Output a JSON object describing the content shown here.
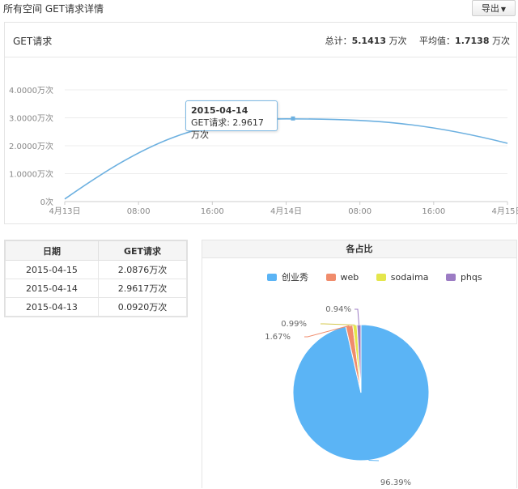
{
  "header": {
    "title": "所有空间 GET请求详情",
    "export_label": "导出"
  },
  "chart_panel": {
    "title": "GET请求",
    "total_label": "总计：",
    "total_value": "5.1413",
    "total_unit": "万次",
    "avg_label": "平均值：",
    "avg_value": "1.7138",
    "avg_unit": "万次"
  },
  "tooltip": {
    "date": "2015-04-14",
    "text": "GET请求: 2.9617万次"
  },
  "chart_data": [
    {
      "type": "line",
      "y_ticks": [
        "0次",
        "1.0000万次",
        "2.0000万次",
        "3.0000万次",
        "4.0000万次"
      ],
      "ylim": [
        0,
        4
      ],
      "x_ticks": [
        "4月13日",
        "08:00",
        "16:00",
        "4月14日",
        "08:00",
        "16:00",
        "4月15日"
      ],
      "x_tick_positions": [
        0,
        8,
        16,
        24,
        32,
        40,
        48
      ],
      "xlim": [
        0,
        48
      ],
      "x": [
        0,
        24,
        48
      ],
      "values": [
        0.092,
        2.9617,
        2.0876
      ],
      "line_color": "#6cb0e0",
      "grid": "horizontal"
    },
    {
      "type": "pie",
      "title": "各占比",
      "legend_placement": "top",
      "slices": [
        {
          "label": "创业秀",
          "value": 96.39,
          "value_label": "96.39%",
          "color": "#5bb4f5"
        },
        {
          "label": "web",
          "value": 1.67,
          "value_label": "1.67%",
          "color": "#f08c6c"
        },
        {
          "label": "sodaima",
          "value": 0.99,
          "value_label": "0.99%",
          "color": "#e4e64c"
        },
        {
          "label": "phqs",
          "value": 0.94,
          "value_label": "0.94%",
          "color": "#9c7cc4"
        }
      ]
    }
  ],
  "table": {
    "headers": [
      "日期",
      "GET请求"
    ],
    "rows": [
      [
        "2015-04-15",
        "2.0876万次"
      ],
      [
        "2015-04-14",
        "2.9617万次"
      ],
      [
        "2015-04-13",
        "0.0920万次"
      ]
    ]
  },
  "icons": {
    "export_caret": "caret-down-icon"
  }
}
